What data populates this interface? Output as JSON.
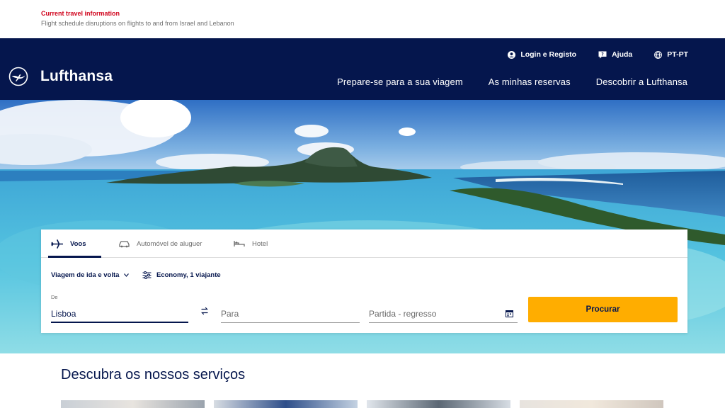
{
  "info_bar": {
    "title": "Current travel information",
    "text": "Flight schedule disruptions on flights to and from Israel and Lebanon"
  },
  "header": {
    "logo_text": "Lufthansa",
    "utility_nav": [
      {
        "label": "Login e Registo",
        "icon": "user-icon"
      },
      {
        "label": "Ajuda",
        "icon": "help-icon"
      },
      {
        "label": "PT-PT",
        "icon": "globe-icon"
      }
    ],
    "main_nav": [
      {
        "label": "Prepare-se para a sua viagem"
      },
      {
        "label": "As minhas reservas"
      },
      {
        "label": "Descobrir a Lufthansa"
      }
    ]
  },
  "booking": {
    "tabs": [
      {
        "label": "Voos",
        "icon": "plane-icon",
        "active": true
      },
      {
        "label": "Automóvel de aluguer",
        "icon": "car-icon",
        "active": false
      },
      {
        "label": "Hotel",
        "icon": "bed-icon",
        "active": false
      }
    ],
    "trip_type": "Viagem de ida e volta",
    "cabin": "Economy, 1 viajante",
    "from_label": "De",
    "from_value": "Lisboa",
    "to_placeholder": "Para",
    "date_placeholder": "Partida - regresso",
    "search_label": "Procurar"
  },
  "services": {
    "title": "Descubra os nossos serviços"
  },
  "colors": {
    "brand_navy": "#05164d",
    "accent_yellow": "#ffad00",
    "alert_red": "#d0021b"
  }
}
